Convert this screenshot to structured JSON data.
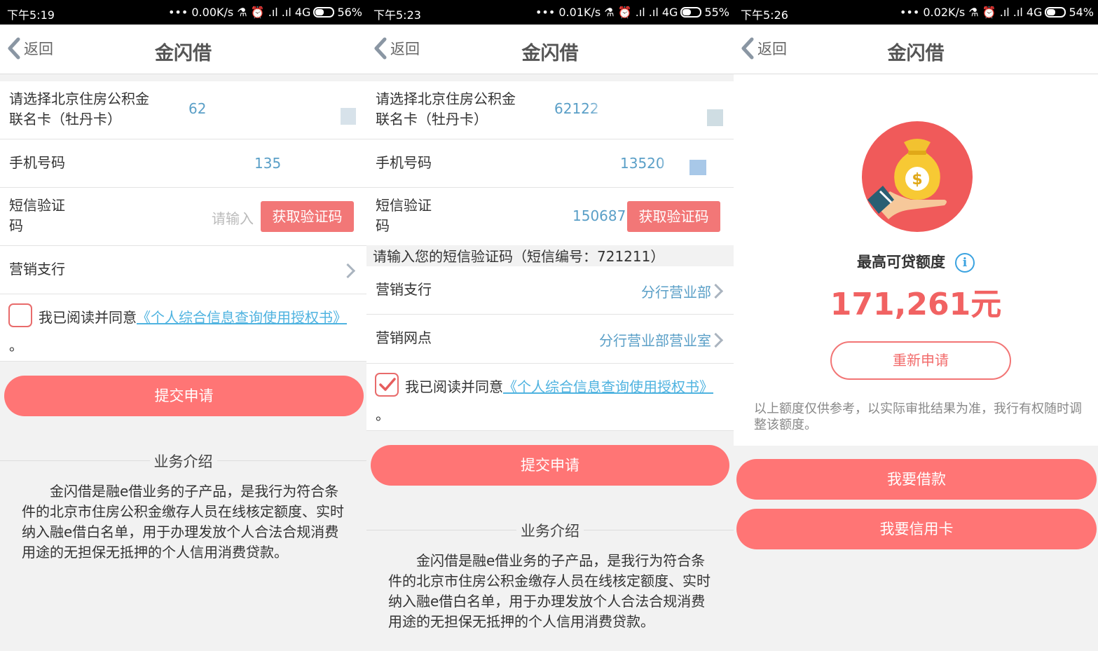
{
  "screens": [
    {
      "status": {
        "time": "下午5:19",
        "network": "••• 0.00K/s ⚗ ⏰ .ıl .ıl 4G",
        "battery": "56%"
      },
      "nav": {
        "back_label": "返回",
        "title": "金闪借"
      },
      "card_row": {
        "label": "请选择北京住房公积金联名卡（牡丹卡）",
        "value": "62"
      },
      "phone_row": {
        "label": "手机号码",
        "value": "135"
      },
      "sms_row": {
        "label": "短信验证码",
        "placeholder": "请输入",
        "button": "获取验证码"
      },
      "branch_row": {
        "label": "营销支行"
      },
      "agreement": {
        "prefix": "我已阅读并同意",
        "link": "《个人综合信息查询使用授权书》",
        "suffix": "。",
        "checked": false
      },
      "submit": "提交申请",
      "intro_title": "业务介绍",
      "intro_text": "金闪借是融e借业务的子产品，是我行为符合条件的北京市住房公积金缴存人员在线核定额度、实时纳入融e借白名单，用于办理发放个人合法合规消费用途的无担保无抵押的个人信用消费贷款。"
    },
    {
      "status": {
        "time": "下午5:23",
        "network": "••• 0.01K/s ⚗ ⏰ .ıl .ıl 4G",
        "battery": "55%"
      },
      "nav": {
        "back_label": "返回",
        "title": "金闪借"
      },
      "card_row": {
        "label": "请选择北京住房公积金联名卡（牡丹卡）",
        "value": "62122"
      },
      "phone_row": {
        "label": "手机号码",
        "value": "13520"
      },
      "sms_row": {
        "label": "短信验证码",
        "value": "150687",
        "button": "获取验证码"
      },
      "sms_hint": "请输入您的短信验证码（短信编号：721211）",
      "branch_row": {
        "label": "营销支行",
        "value": "分行营业部"
      },
      "outlet_row": {
        "label": "营销网点",
        "value": "分行营业部营业室"
      },
      "agreement": {
        "prefix": "我已阅读并同意",
        "link": "《个人综合信息查询使用授权书》",
        "suffix": "。",
        "checked": true
      },
      "submit": "提交申请",
      "intro_title": "业务介绍",
      "intro_text": "金闪借是融e借业务的子产品，是我行为符合条件的北京市住房公积金缴存人员在线核定额度、实时纳入融e借白名单，用于办理发放个人合法合规消费用途的无担保无抵押的个人信用消费贷款。"
    },
    {
      "status": {
        "time": "下午5:26",
        "network": "••• 0.02K/s ⚗ ⏰ .ıl .ıl 4G",
        "battery": "54%"
      },
      "nav": {
        "back_label": "返回",
        "title": "金闪借"
      },
      "hero_icon": "money-bag-hand-icon",
      "limit_label": "最高可贷额度",
      "limit_value": "171,261元",
      "reapply": "重新申请",
      "disclaimer": "以上额度仅供参考，以实际审批结果为准，我行有权随时调整该额度。",
      "loan_button": "我要借款",
      "credit_button": "我要信用卡"
    }
  ],
  "colors": {
    "accent": "#ff7575",
    "link": "#4fb3e0",
    "value": "#5a9fc7",
    "limit": "#f16262"
  }
}
